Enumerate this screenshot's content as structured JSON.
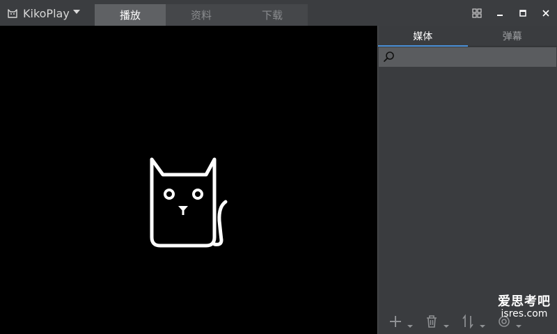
{
  "app": {
    "name": "KikoPlay"
  },
  "main_tabs": [
    {
      "label": "播放",
      "active": true
    },
    {
      "label": "资料",
      "active": false
    },
    {
      "label": "下载",
      "active": false
    }
  ],
  "window_controls": [
    "grid-icon",
    "minimize-icon",
    "maximize-icon",
    "close-icon"
  ],
  "side_tabs": [
    {
      "label": "媒体",
      "active": true
    },
    {
      "label": "弹幕",
      "active": false
    }
  ],
  "search": {
    "value": "",
    "placeholder": ""
  },
  "footer_buttons": [
    "add-icon",
    "trash-icon",
    "sort-icon",
    "eye-icon"
  ],
  "watermark": {
    "line1": "爱思考吧",
    "line2": "isres.com"
  },
  "colors": {
    "accent": "#4a90d9",
    "active_tab": "#5f6164",
    "panel": "#3a3c3f",
    "video_bg": "#000000"
  }
}
